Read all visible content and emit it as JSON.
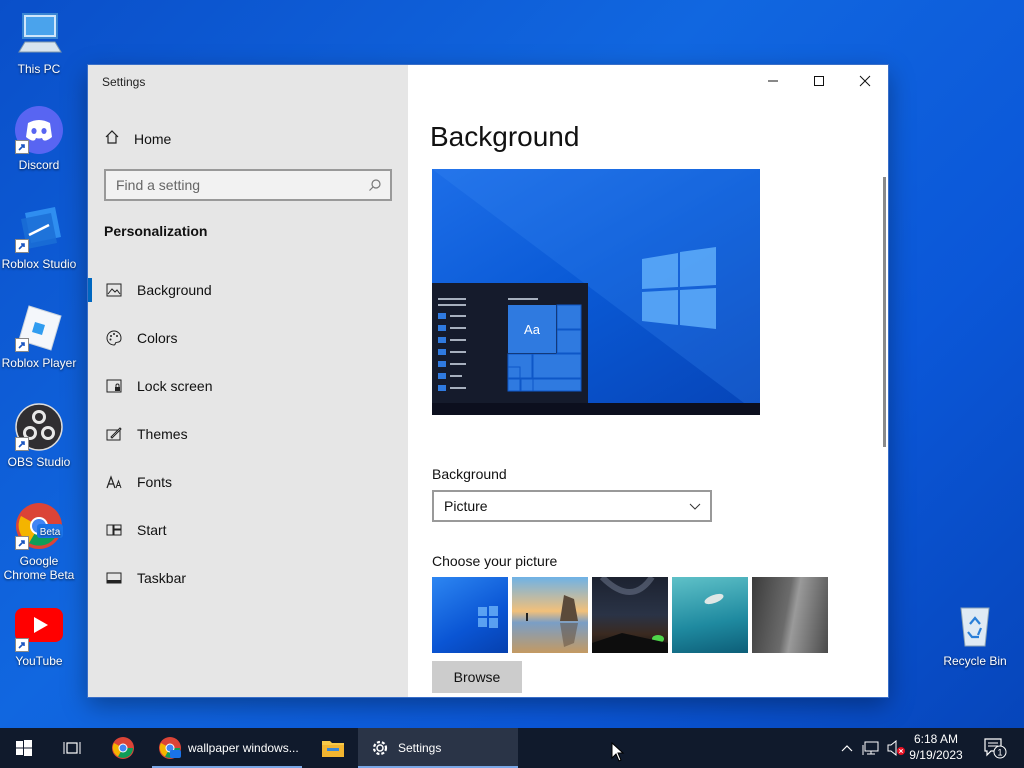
{
  "desktop": {
    "icons": [
      {
        "label": "This PC"
      },
      {
        "label": "Discord"
      },
      {
        "label": "Roblox Studio"
      },
      {
        "label": "Roblox Player"
      },
      {
        "label": "OBS Studio"
      },
      {
        "label": "Google Chrome Beta"
      },
      {
        "label": "YouTube"
      },
      {
        "label": "Recycle Bin"
      }
    ],
    "chrome_beta_badge": "Beta"
  },
  "window": {
    "title": "Settings",
    "home_label": "Home",
    "search_placeholder": "Find a setting",
    "section": "Personalization",
    "nav": [
      {
        "label": "Background",
        "icon": "picture-icon",
        "active": true
      },
      {
        "label": "Colors",
        "icon": "palette-icon"
      },
      {
        "label": "Lock screen",
        "icon": "lock-screen-icon"
      },
      {
        "label": "Themes",
        "icon": "brush-icon"
      },
      {
        "label": "Fonts",
        "icon": "fonts-icon"
      },
      {
        "label": "Start",
        "icon": "start-icon"
      },
      {
        "label": "Taskbar",
        "icon": "taskbar-icon"
      }
    ],
    "page_title": "Background",
    "preview_tile_text": "Aa",
    "background_label": "Background",
    "background_value": "Picture",
    "choose_label": "Choose your picture",
    "browse_label": "Browse"
  },
  "taskbar": {
    "apps": [
      {
        "label": "wallpaper windows..."
      },
      {
        "label": "Settings"
      }
    ],
    "time": "6:18 AM",
    "date": "9/19/2023",
    "notification_count": "1"
  },
  "colors": {
    "accent": "#0067c0",
    "taskbar": "#101a2c",
    "sidebar": "#e6e6e6"
  }
}
